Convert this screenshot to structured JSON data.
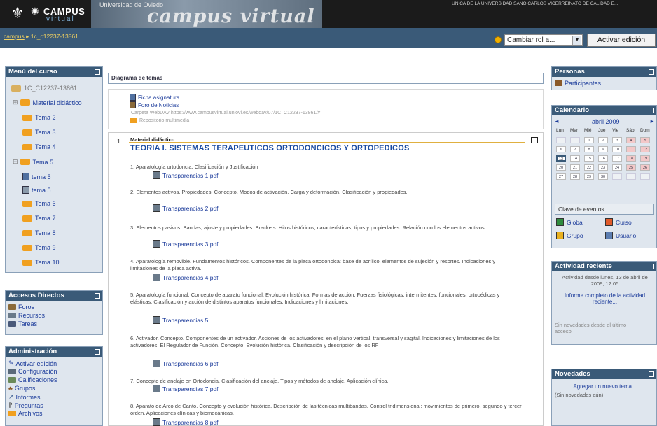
{
  "header": {
    "logo_top": "CAMPUS",
    "logo_bottom": "virtual",
    "banner_subtitle": "Universidad de Oviedo",
    "banner_title": "campus virtual",
    "right_text": "ÚNICA DE LA UNIVERSIDAD SANO CARLOS VICERREINATO DE CALIDAD E..."
  },
  "nav": {
    "breadcrumb_home": "campus",
    "breadcrumb_sep": "▸",
    "breadcrumb_course": "1c_c12237-13861",
    "role_select": "Cambiar rol a...",
    "edit_button": "Activar edición"
  },
  "course_menu": {
    "title": "Menú del curso",
    "items": [
      {
        "label": "1C_C12237-13861",
        "icon": "course-folder-icon"
      },
      {
        "label": "Material didáctico",
        "icon": "folder-icon"
      },
      {
        "label": "Tema 2",
        "icon": "folder-icon"
      },
      {
        "label": "Tema 3",
        "icon": "folder-icon"
      },
      {
        "label": "Tema 4",
        "icon": "folder-icon"
      },
      {
        "label": "Tema 5",
        "icon": "folder-icon"
      },
      {
        "label": "tema 5",
        "icon": "doc-icon"
      },
      {
        "label": "tema 5",
        "icon": "doc-icon"
      },
      {
        "label": "Tema 6",
        "icon": "folder-icon"
      },
      {
        "label": "Tema 7",
        "icon": "folder-icon"
      },
      {
        "label": "Tema 8",
        "icon": "folder-icon"
      },
      {
        "label": "Tema 9",
        "icon": "folder-icon"
      },
      {
        "label": "Tema 10",
        "icon": "folder-icon"
      }
    ]
  },
  "shortcuts": {
    "title": "Accesos Directos",
    "items": [
      "Foros",
      "Recursos",
      "Tareas"
    ]
  },
  "admin": {
    "title": "Administración",
    "items": [
      "Activar edición",
      "Configuración",
      "Calificaciones",
      "Grupos",
      "Informes",
      "Preguntas",
      "Archivos"
    ]
  },
  "diagram": {
    "title": "Diagrama de temas"
  },
  "resources": {
    "items": [
      "Ficha asignatura",
      "Foro de Noticias"
    ],
    "webdav": "Carpeta WebDAV https://www.campusvirtual.uniovi.es/webdav/07/1C_C12237-13861/#",
    "repo": "Repositorio multimedia"
  },
  "topic": {
    "number": "1",
    "label": "Material didáctico",
    "title": "TEORIA I. SISTEMAS TERAPEUTICOS ORTODONCICOS Y ORTOPEDICOS",
    "units": [
      {
        "text": "1. Aparatología ortodoncia. Clasificación y Justificación",
        "pdf": "Transparencias 1.pdf"
      },
      {
        "text": "2. Elementos activos. Propiedades. Concepto. Modos de activación. Carga y deformación. Clasificación y propiedades.",
        "pdf": "Transparencias 2.pdf"
      },
      {
        "text": "3. Elementos pasivos. Bandas, ajuste y propiedades. Brackets: Hitos históricos, características, tipos y propiedades. Relación con los elementos activos.",
        "pdf": "Transparencias 3.pdf"
      },
      {
        "text": "4. Aparatología removible. Fundamentos históricos. Componentes de la placa ortodoncica: base de acrílico, elementos de sujeción y resortes. Indicaciones y limitaciones de la placa activa.",
        "pdf": "Transparencias 4.pdf"
      },
      {
        "text": "5. Aparatología funcional. Concepto de aparato funcional. Evolución histórica. Formas de acción: Fuerzas fisiológicas, intermitentes, funcionales, ortopédicas y elásticas. Clasificación y acción de distintos aparatos funcionales. Indicaciones y limitaciones.",
        "pdf": "Transparencias 5"
      },
      {
        "text": "6. Activador. Concepto. Componentes de un activador. Acciones de los activadores: en el plano vertical, transversal y sagital. Indicaciones y limitaciones de los activadores. El Regulador de Función. Concepto: Evolución histórica. Clasificación y descripción de los RF",
        "pdf": "Transparencias 6.pdf"
      },
      {
        "text": "7. Concepto de anclaje en Ortodoncia. Clasificación del anclaje. Tipos y métodos de anclaje. Aplicación clínica.",
        "pdf": "Transparencias 7.pdf"
      },
      {
        "text": "8. Aparato de Arco de Canto. Concepto y evolución histórica. Descripción de las técnicas multibandas. Control tridimensional: movimientos de primero, segundo y tercer orden. Aplicaciones clínicas y biomecánicas.",
        "pdf": "Transparencias 8.pdf"
      }
    ]
  },
  "people": {
    "title": "Personas",
    "participants": "Participantes"
  },
  "calendar": {
    "title": "Calendario",
    "month": "abril 2009",
    "prev": "◄",
    "next": "►",
    "weekdays": [
      "Lun",
      "Mar",
      "Mié",
      "Jue",
      "Vie",
      "Sáb",
      "Dom"
    ],
    "days": [
      "",
      "",
      "1",
      "2",
      "3",
      "4",
      "5",
      "6",
      "7",
      "8",
      "9",
      "10",
      "11",
      "12",
      "13",
      "14",
      "15",
      "16",
      "17",
      "18",
      "19",
      "20",
      "21",
      "22",
      "23",
      "24",
      "25",
      "26",
      "27",
      "28",
      "29",
      "30",
      "",
      "",
      ""
    ],
    "events_title": "Clave de eventos",
    "events": [
      "Global",
      "Curso",
      "Grupo",
      "Usuario"
    ],
    "colors": {
      "global": "#2e8b3e",
      "curso": "#e05a2a",
      "grupo": "#e8b020",
      "usuario": "#5b7db0",
      "weekend": "#f3c8c8",
      "today": "#3a5a78"
    }
  },
  "recent": {
    "title": "Actividad reciente",
    "since": "Actividad desde lunes, 13 de abril de 2009, 12:05",
    "full_report": "Informe completo de la actividad reciente...",
    "none": "Sin novedades desde el último acceso"
  },
  "news": {
    "title": "Novedades",
    "add": "Agregar un nuevo tema...",
    "none": "(Sin novedades aún)"
  }
}
